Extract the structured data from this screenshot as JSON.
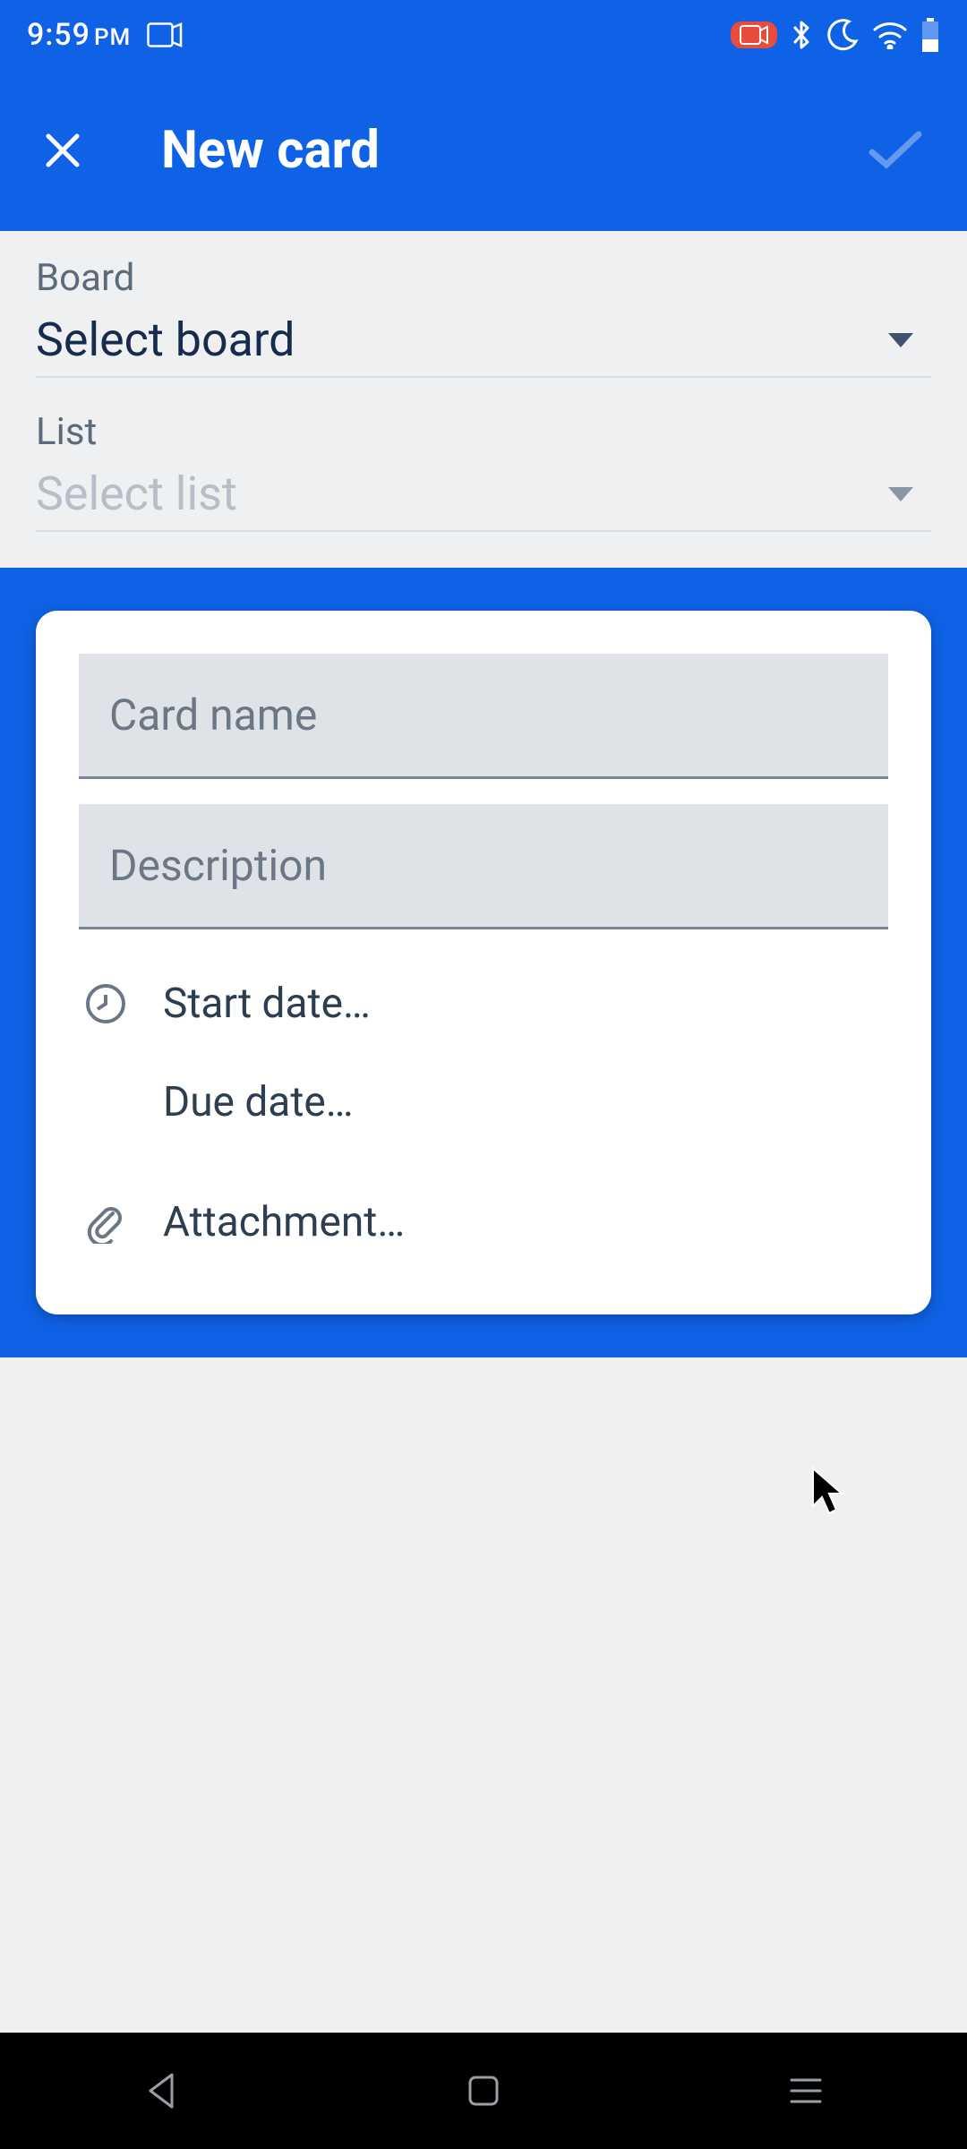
{
  "status": {
    "time": "9:59",
    "ampm": "PM"
  },
  "appbar": {
    "title": "New card"
  },
  "selectors": {
    "board": {
      "label": "Board",
      "value": "Select board"
    },
    "list": {
      "label": "List",
      "value": "Select list"
    }
  },
  "card": {
    "name_placeholder": "Card name",
    "desc_placeholder": "Description",
    "start_date_label": "Start date…",
    "due_date_label": "Due date…",
    "attachment_label": "Attachment…"
  }
}
